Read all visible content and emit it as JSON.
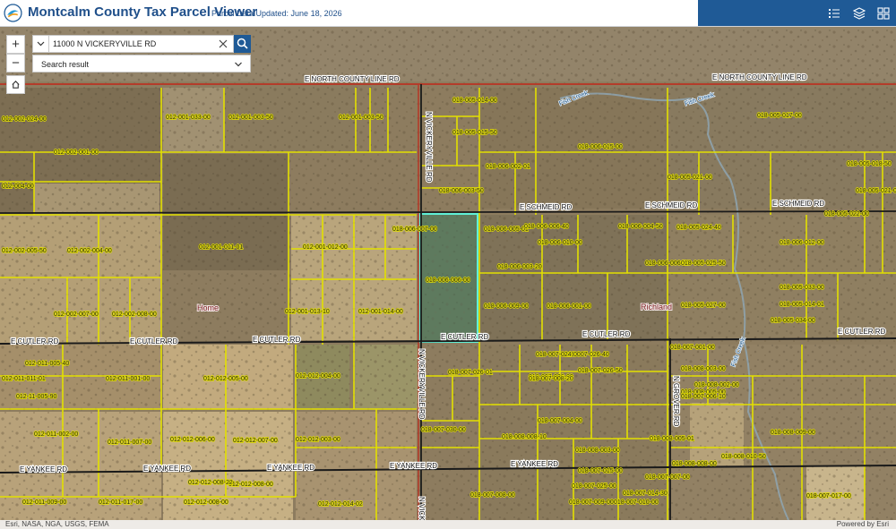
{
  "header": {
    "title": "Montcalm County Tax Parcel Viewer",
    "subtitle": "Parcel Data Updated: June 18, 2026",
    "icons": [
      "list-icon",
      "layers-icon",
      "grid-icon"
    ]
  },
  "search": {
    "value": "11000 N VICKERYVILLE RD",
    "result_label": "Search result"
  },
  "controls": {
    "zoom_in": "+",
    "zoom_out": "−"
  },
  "attribution": {
    "left": "Esri, NASA, NGA, USGS, FEMA",
    "right": "Powered by Esri"
  },
  "colors": {
    "parcel_line": "#e3e000",
    "selected_parcel": "#5ff0d6",
    "road": "#1a1a1a",
    "county_line": "#b43c2a",
    "header_accent": "#1f5a96"
  },
  "map": {
    "roads": [
      "E NORTH COUNTY LINE RD",
      "E NORTH COUNTY LINE RD",
      "N VICKERYVILLE RD",
      "N VICKERYVILLE RD",
      "N VICKE",
      "E SCHMEID RD",
      "E SCHMEID RD",
      "E SCHMEID RD",
      "E CUTLER RD",
      "E CUTLER RD",
      "E CUTLER RD",
      "E CUTLER RD",
      "E CUTLER RD",
      "E CUTLER RD",
      "E YANKEE RD",
      "E YANKEE RD",
      "E YANKEE RD",
      "E YANKEE RD",
      "E YANKEE RD",
      "N GROVER RD"
    ],
    "places": [
      "Home",
      "Richland"
    ],
    "streams": [
      "Fish Creek",
      "Fish Creek",
      "Fish Creek"
    ],
    "parcels": [
      "012-002-024-00",
      "012-001-033-00",
      "012-001-003-50",
      "012-001-003-50",
      "012-002-001-00",
      "012-004-00",
      "012-002-005-50",
      "012-002-004-00",
      "012-001-011-01",
      "012-001-012-00",
      "012-002-007-00",
      "012-002-008-00",
      "012-001-013-10",
      "012-001-014-00",
      "012-011-005-40",
      "012-011-011-01",
      "012-011-001-00",
      "012-012-005-00",
      "012-012-004-00",
      "012-11-005-90",
      "012-011-002-00",
      "012-011-007-00",
      "012-012-006-00",
      "012-012-007-00",
      "012-012-008-00",
      "012-012-008-22",
      "012-012-003-00",
      "012-012-014-02",
      "012-011-009-00",
      "012-011-017-00",
      "012-012-008-00",
      "018-005-014-00",
      "018-005-015-50",
      "018-006-002-01",
      "018-006-003-50",
      "018-006-005-01",
      "018-006-015-00",
      "018-005-021-00",
      "018-005-017-00",
      "018-005-018-50",
      "018-005-021-00",
      "018-005-022-00",
      "018-006-006-00",
      "018-006-007-00",
      "018-006-006-40",
      "018-006-010-00",
      "018-006-003-20",
      "018-006-004-50",
      "018-006-006-50",
      "018-005-025-50",
      "018-006-009-00",
      "018-006-001-00",
      "018-005-027-00",
      "018-005-024-40",
      "018-005-033-00",
      "018-005-014-01",
      "018-005-034-00",
      "018-006-012-00",
      "018-007-001-00",
      "018-007-026-40",
      "018-007-026-01",
      "018-007-026-00",
      "018-007-026-50",
      "018-007-024-00",
      "018-008-003-00",
      "018-008-005-00",
      "018-008-005-01",
      "018-008-002-00",
      "018-008-008-10",
      "018-007-004-00",
      "018-007-030-00",
      "018-007-008-00",
      "018-007-009-00",
      "018-007-010-00",
      "018-008-009-00",
      "018-008-010-50",
      "018-008-003-00",
      "018-008-008-00",
      "018-007-017-00",
      "018-007-015-00",
      "018-007-025-00",
      "018-007-014-30",
      "018-007-006-10",
      "018-007-007-00",
      "018-007-008-20"
    ]
  }
}
